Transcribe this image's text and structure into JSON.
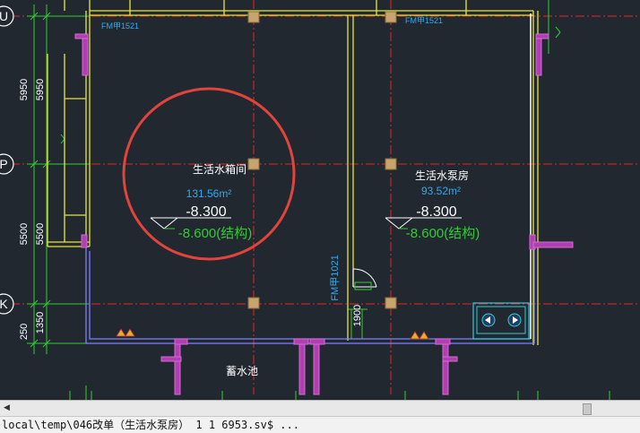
{
  "grid_axes": {
    "u": "U",
    "p": "P",
    "k": "K"
  },
  "dimensions": {
    "left_outer_1": "5950",
    "left_inner_1": "5950",
    "left_outer_2": "5500",
    "left_inner_2": "5500",
    "left_outer_3": "250",
    "left_inner_3": "1350",
    "door_width": "1900"
  },
  "rooms": {
    "tank": {
      "name": "生活水箱间",
      "area": "131.56m²",
      "elev_finish": "-8.300",
      "elev_struct": "-8.600(结构)"
    },
    "pump": {
      "name": "生活水泵房",
      "area": "93.52m²",
      "elev_finish": "-8.300",
      "elev_struct": "-8.600(结构)"
    },
    "reservoir": {
      "name": "蓄水池"
    }
  },
  "doors": {
    "door_vertical": "FM甲1021",
    "door_top_left": "FM甲1521",
    "door_top_right": "FM甲1521"
  },
  "colors": {
    "background": "#212830",
    "wall": "#e6e63a",
    "axis": "#e02828",
    "dimension": "#33cc33",
    "column_fill": "#c8a46e",
    "magenta": "#c848c8",
    "area_text": "#33aaee",
    "highlight_circle": "#e0443c",
    "text": "#ffffff"
  },
  "icons": {
    "nav_left": "arrow-left-icon",
    "nav_right": "arrow-right-icon",
    "warning": "triangle-icon"
  },
  "status": {
    "command_line": "local\\temp\\046改单（生活水泵房） 1 1 6953.sv$ ..."
  }
}
